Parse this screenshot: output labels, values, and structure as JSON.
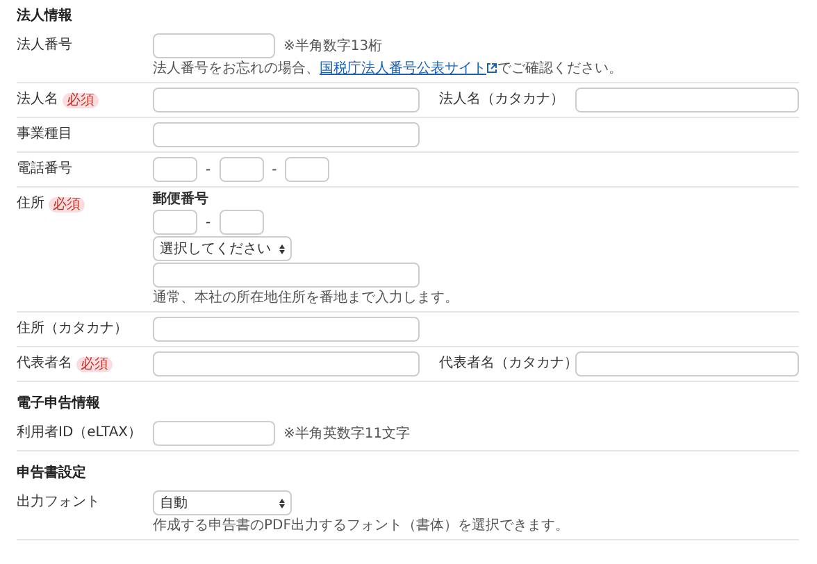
{
  "sections": [
    {
      "title": "法人情報",
      "rows": [
        {
          "kind": "code",
          "label": "法人番号",
          "note": "※半角数字13桁",
          "hint": {
            "before": "法人番号をお忘れの場合、",
            "link": "国税庁法人番号公表サイト",
            "after": "でご確認ください。"
          }
        },
        {
          "kind": "text",
          "label": "法人名",
          "badge": "必須",
          "pair": {
            "label": "法人名（カタカナ）"
          }
        },
        {
          "kind": "text",
          "label": "事業種目"
        },
        {
          "kind": "phone",
          "label": "電話番号",
          "separators": [
            "-",
            "-"
          ]
        },
        {
          "kind": "address",
          "label": "住所",
          "badge": "必須",
          "postal_label": "郵便番号",
          "separator": "-",
          "select": "選択してください",
          "hint_text": "通常、本社の所在地住所を番地まで入力します。"
        },
        {
          "kind": "text",
          "label": "住所（カタカナ）"
        },
        {
          "kind": "text",
          "label": "代表者名",
          "badge": "必須",
          "pair": {
            "label": "代表者名（カタカナ）"
          }
        }
      ]
    },
    {
      "title": "電子申告情報",
      "rows": [
        {
          "kind": "code",
          "label": "利用者ID（eLTAX）",
          "note": "※半角英数字11文字"
        }
      ]
    },
    {
      "title": "申告書設定",
      "rows": [
        {
          "kind": "select",
          "label": "出力フォント",
          "select": "自動",
          "hint_text": "作成する申告書のPDF出力するフォント（書体）を選択できます。"
        }
      ]
    }
  ]
}
